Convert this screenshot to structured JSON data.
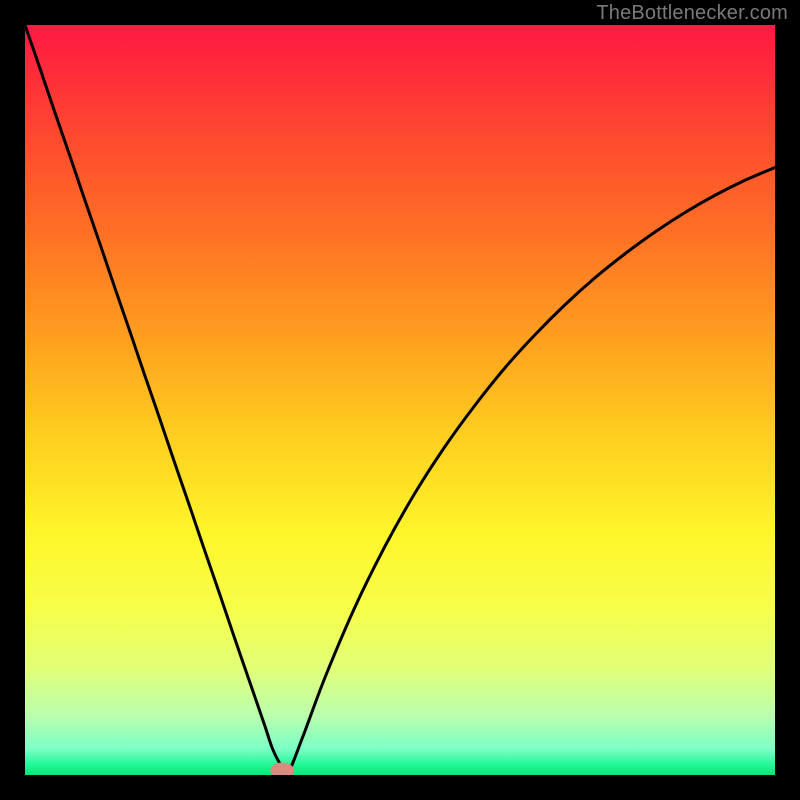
{
  "attribution": "TheBottlenecker.com",
  "chart_data": {
    "type": "line",
    "title": "",
    "xlabel": "",
    "ylabel": "",
    "ylim": [
      0,
      100
    ],
    "xlim": [
      0,
      100
    ],
    "x": [
      0,
      2,
      4,
      6,
      8,
      10,
      12,
      14,
      16,
      18,
      20,
      22,
      24,
      26,
      28,
      30,
      31,
      32,
      33,
      34,
      35,
      37,
      40,
      44,
      48,
      52,
      56,
      60,
      64,
      68,
      72,
      76,
      80,
      84,
      88,
      92,
      96,
      100
    ],
    "values": [
      100,
      94.2,
      88.3,
      82.5,
      76.6,
      70.8,
      64.9,
      59.1,
      53.2,
      47.4,
      41.5,
      35.7,
      29.8,
      24.0,
      18.1,
      12.3,
      9.4,
      6.5,
      3.5,
      1.5,
      0.2,
      5.0,
      13.0,
      22.4,
      30.5,
      37.6,
      43.8,
      49.3,
      54.3,
      58.7,
      62.7,
      66.3,
      69.5,
      72.4,
      75.0,
      77.3,
      79.3,
      81.0
    ],
    "minimum_marker": {
      "x": 34.3,
      "y": 0.6
    },
    "gradient_stops": [
      {
        "offset": 0.0,
        "color": "#ff1a43"
      },
      {
        "offset": 0.06,
        "color": "#ff2b3a"
      },
      {
        "offset": 0.15,
        "color": "#ff4a2f"
      },
      {
        "offset": 0.28,
        "color": "#ff7125"
      },
      {
        "offset": 0.42,
        "color": "#ffa01f"
      },
      {
        "offset": 0.55,
        "color": "#ffcf1f"
      },
      {
        "offset": 0.68,
        "color": "#fff62a"
      },
      {
        "offset": 0.78,
        "color": "#f6ff4a"
      },
      {
        "offset": 0.86,
        "color": "#e0ff7a"
      },
      {
        "offset": 0.92,
        "color": "#baffad"
      },
      {
        "offset": 0.965,
        "color": "#7dffc6"
      },
      {
        "offset": 0.985,
        "color": "#27f89a"
      },
      {
        "offset": 1.0,
        "color": "#00e876"
      }
    ]
  }
}
